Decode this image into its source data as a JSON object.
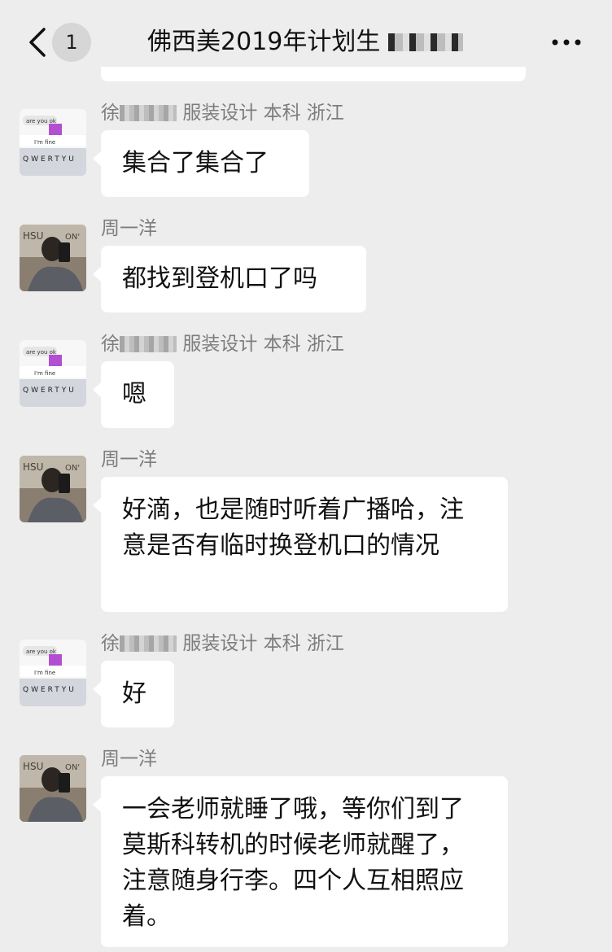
{
  "header": {
    "back_icon": "chevron-left-icon",
    "unread_count": "1",
    "title": "佛西美2019年计划生",
    "more_icon": "more-horizontal-icon"
  },
  "messages": [
    {
      "sender": "徐",
      "sender_suffix": "服装设计 本科 浙江",
      "text": "集合了集合了",
      "avatar": "keyboard-chat-avatar"
    },
    {
      "sender": "周一洋",
      "sender_suffix": "",
      "text": "都找到登机口了吗",
      "avatar": "mirror-selfie-avatar"
    },
    {
      "sender": "徐",
      "sender_suffix": "服装设计 本科 浙江",
      "text": "嗯",
      "avatar": "keyboard-chat-avatar"
    },
    {
      "sender": "周一洋",
      "sender_suffix": "",
      "text": "好滴，也是随时听着广播哈，注意是否有临时换登机口的情况",
      "avatar": "mirror-selfie-avatar"
    },
    {
      "sender": "徐",
      "sender_suffix": "服装设计 本科 浙江",
      "text": "好",
      "avatar": "keyboard-chat-avatar"
    },
    {
      "sender": "周一洋",
      "sender_suffix": "",
      "text": "一会老师就睡了哦，等你们到了莫斯科转机的时候老师就醒了，注意随身行李。四个人互相照应着。",
      "avatar": "mirror-selfie-avatar"
    }
  ],
  "avatar_keyboard": {
    "line1": "are you ok",
    "line2": "I'm fine",
    "keys": "QWERTYU"
  },
  "colors": {
    "background": "#ededed",
    "bubble": "#ffffff",
    "name": "#7d7d7d",
    "text": "#111111"
  }
}
